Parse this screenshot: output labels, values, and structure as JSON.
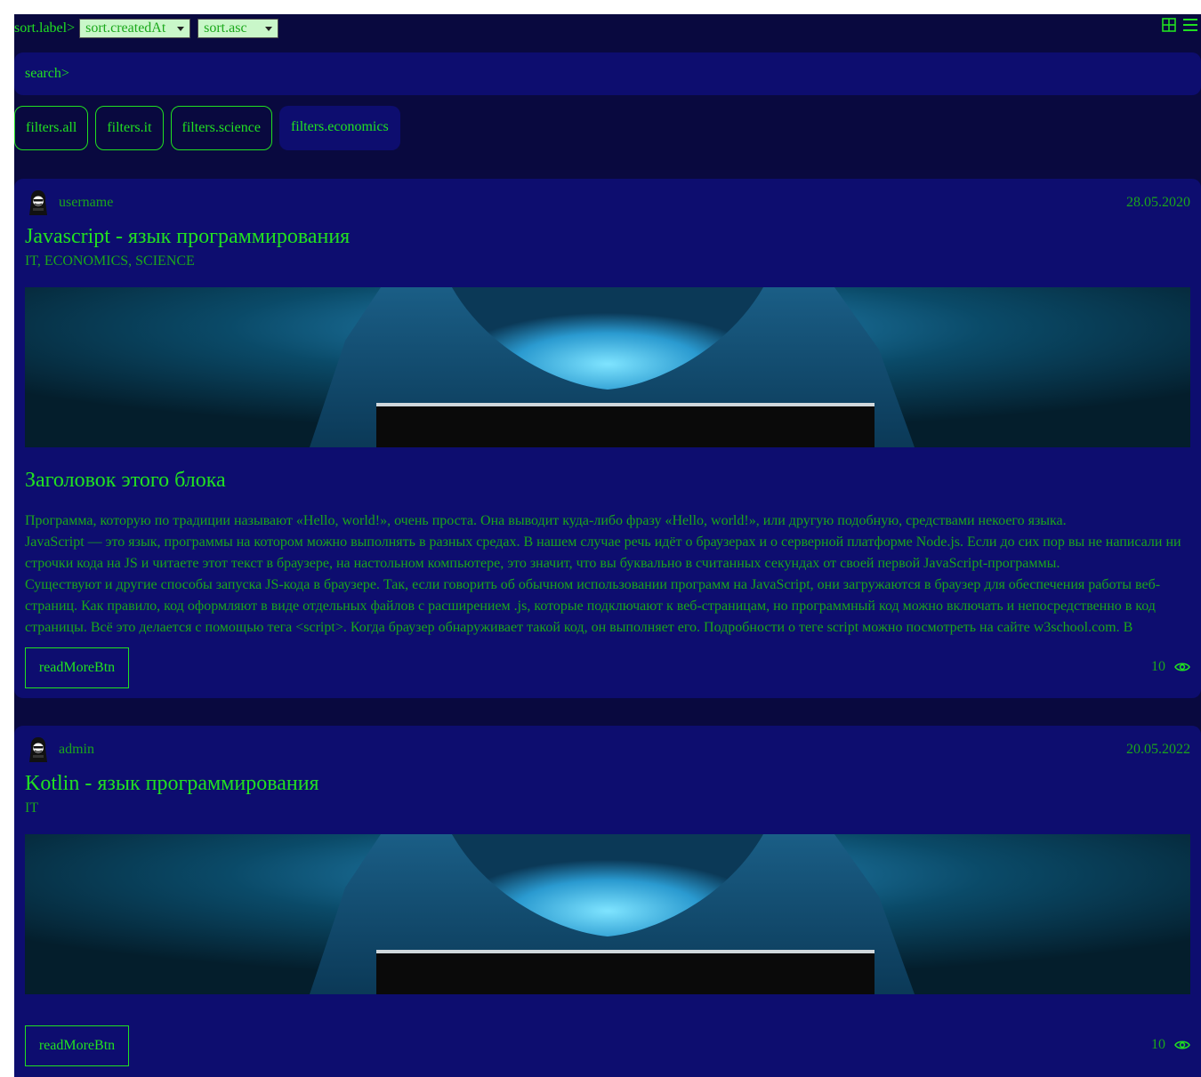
{
  "sort": {
    "label": "sort.label>",
    "field_selected": "sort.createdAt",
    "order_selected": "sort.asc"
  },
  "view_icons": [
    "grid-view-icon",
    "list-view-icon"
  ],
  "search": {
    "placeholder": "search>"
  },
  "filters": [
    {
      "label": "filters.all",
      "active": false
    },
    {
      "label": "filters.it",
      "active": false
    },
    {
      "label": "filters.science",
      "active": false
    },
    {
      "label": "filters.economics",
      "active": true
    }
  ],
  "colors": {
    "background": "#09093f",
    "card": "#0d0d6f",
    "accent": "#21e021",
    "text_dim": "#1ba61b"
  },
  "posts": [
    {
      "author": "username",
      "date": "28.05.2020",
      "title": "Javascript - язык программирования",
      "tags": "IT, ECONOMICS, SCIENCE",
      "block_title": "Заголовок этого блока",
      "paragraphs": [
        "Программа, которую по традиции называют «Hello, world!», очень проста. Она выводит куда-либо фразу «Hello, world!», или другую подобную, средствами некоего языка.",
        "JavaScript — это язык, программы на котором можно выполнять в разных средах. В нашем случае речь идёт о браузерах и о серверной платформе Node.js. Если до сих пор вы не написали ни строчки кода на JS и читаете этот текст в браузере, на настольном компьютере, это значит, что вы буквально в считанных секундах от своей первой JavaScript-программы.",
        "Существуют и другие способы запуска JS-кода в браузере. Так, если говорить об обычном использовании программ на JavaScript, они загружаются в браузер для обеспечения работы веб-страниц. Как правило, код оформляют в виде отдельных файлов с расширением .js, которые подключают к веб-страницам, но программный код можно включать и непосредственно в код страницы. Всё это делается с помощью тега <script>. Когда браузер обнаруживает такой код, он выполняет его. Подробности о теге script можно посмотреть на сайте w3school.com. В"
      ],
      "read_more": "readMoreBtn",
      "views": "10"
    },
    {
      "author": "admin",
      "date": "20.05.2022",
      "title": "Kotlin - язык программирования",
      "tags": "IT",
      "read_more": "readMoreBtn",
      "views": "10"
    }
  ]
}
